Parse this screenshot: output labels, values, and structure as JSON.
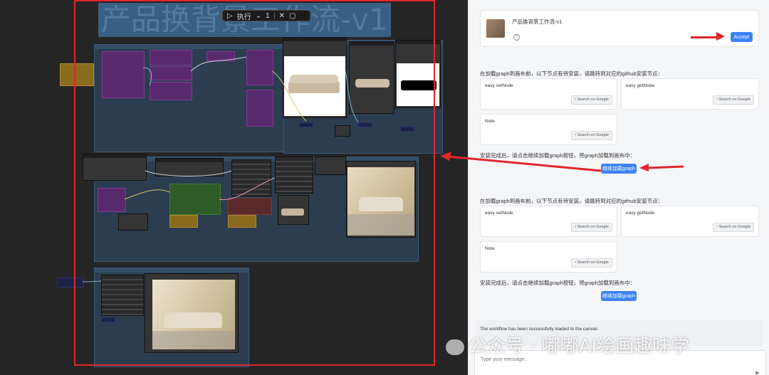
{
  "canvas": {
    "watermark_title": "产品换背景工作流-v1",
    "toolbar": {
      "run_label": "执行",
      "count": "1"
    }
  },
  "panel": {
    "workflow_card": {
      "title": "产品换背景工作流-v1",
      "help": "?",
      "accept_label": "Accept"
    },
    "sections": [
      {
        "intro": "在加载graph到画布前，以下节点有待安装，请跳转到对应的github安装节点：",
        "nodes": [
          {
            "name": "easy setNode",
            "search_label": "Search on Google"
          },
          {
            "name": "easy getNode",
            "search_label": "Search on Google"
          },
          {
            "name": "Note",
            "search_label": "Search on Google"
          }
        ],
        "after": "安装完成后，请点击继续加载graph按钮，将graph加载到画布中：",
        "continue_label": "继续加载graph"
      },
      {
        "intro": "在加载graph到画布前，以下节点有待安装，请跳转到对应的github安装节点：",
        "nodes": [
          {
            "name": "easy setNode",
            "search_label": "Search on Google"
          },
          {
            "name": "easy getNode",
            "search_label": "Search on Google"
          },
          {
            "name": "Note",
            "search_label": "Search on Google"
          }
        ],
        "after": "安装完成后，请点击继续加载graph按钮，将graph加载到画布中：",
        "continue_label": "继续加载graph"
      }
    ],
    "status_message": "The workflow has been successfully loaded to the canvas",
    "input_placeholder": "Type your message..."
  },
  "watermark": {
    "text": "公众号 · 嘟嘟AI绘画趣味学"
  },
  "colors": {
    "accent": "#3b82f6",
    "annotation": "#e0262c"
  }
}
